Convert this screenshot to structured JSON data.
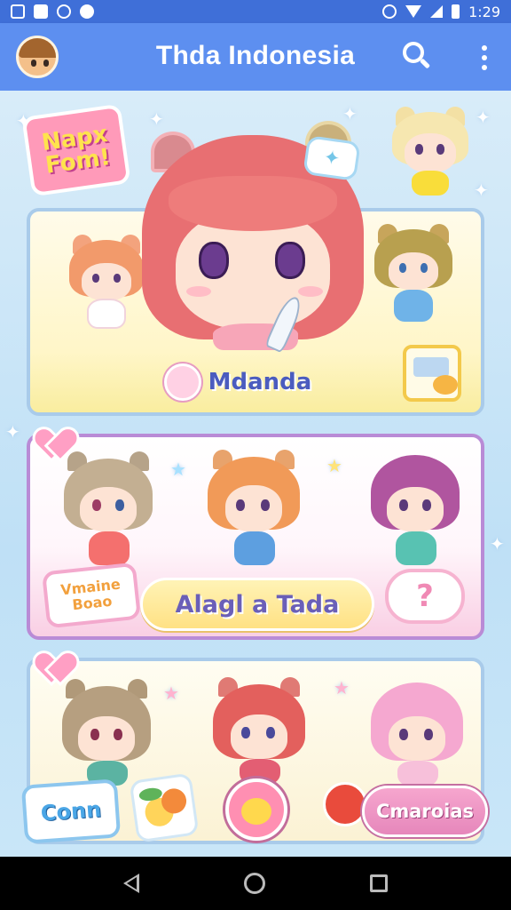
{
  "status_bar": {
    "time": "1:29"
  },
  "app_bar": {
    "title": "Thda Indonesia"
  },
  "hero": {
    "sticker_text": "Napx Fom!"
  },
  "card_1": {
    "label": "Mdanda"
  },
  "card_2": {
    "sticker_text": "Vmaine Boao",
    "label": "Alagl a Tada"
  },
  "card_3": {
    "sticker_text": "Conn",
    "label": "Cmaroias"
  },
  "colors": {
    "app_bar": "#5d8ff0",
    "status_bar": "#3f6fd8",
    "card_purple": "#b98bd6",
    "card_blue": "#a9cbea",
    "pill_pink": "#f48fb7"
  }
}
